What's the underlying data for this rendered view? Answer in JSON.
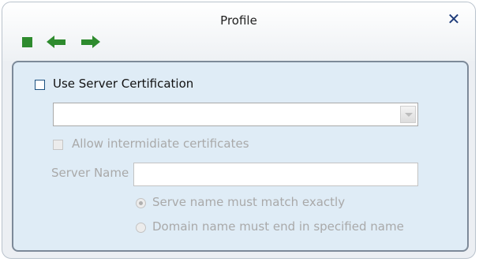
{
  "window": {
    "title": "Profile"
  },
  "toolbar": {
    "buttons": [
      {
        "icon": "stop-square-icon",
        "color": "#2e8b2e"
      },
      {
        "icon": "arrow-left-icon",
        "color": "#2e8b2e"
      },
      {
        "icon": "arrow-right-icon",
        "color": "#2e8b2e"
      }
    ]
  },
  "form": {
    "use_server_cert": {
      "label": "Use Server Certification",
      "checked": false
    },
    "certificate_select": {
      "value": "",
      "disabled": true
    },
    "allow_intermediate": {
      "label": "Allow intermidiate certificates",
      "checked": false,
      "disabled": true
    },
    "server_name": {
      "label": "Server Name",
      "value": "",
      "disabled": true
    },
    "match_options": [
      {
        "label": "Serve name must match exactly",
        "selected": true,
        "disabled": true
      },
      {
        "label": "Domain name must end in specified name",
        "selected": false,
        "disabled": true
      }
    ]
  },
  "colors": {
    "accent": "#2e8b2e",
    "panel_bg": "#dfecf6",
    "close": "#1f3c7a",
    "disabled_text": "#a9a9a9"
  }
}
